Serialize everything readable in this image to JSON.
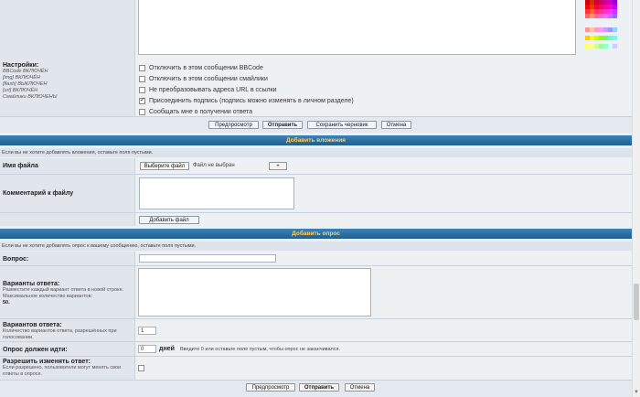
{
  "settings": {
    "title": "Настройки:",
    "status": [
      "BBCode ВКЛЮЧЁН",
      "[img] ВКЛЮЧЁН",
      "[flash] ВЫКЛЮЧЕН",
      "[url] ВКЛЮЧЁН",
      "Смайлики ВКЛЮЧЕНЫ"
    ],
    "options": [
      {
        "label": "Отключить в этом сообщении BBCode",
        "checked": false
      },
      {
        "label": "Отключить в этом сообщении смайлики",
        "checked": false
      },
      {
        "label": "Не преобразовывать адреса URL в ссылки",
        "checked": false
      },
      {
        "label": "Присоединить подпись (подпись можно изменять в личном разделе)",
        "checked": true
      },
      {
        "label": "Сообщать мне о получении ответа",
        "checked": false
      }
    ]
  },
  "buttons": {
    "preview": "Предпросмотр",
    "submit": "Отправить",
    "save_draft": "Сохранить черновик",
    "cancel": "Отмена"
  },
  "attachments": {
    "header": "Добавить вложения",
    "note": "Если вы не хотите добавлять вложения, оставьте поля пустыми.",
    "file_label": "Имя файла",
    "choose_file": "Выберите файл",
    "no_file": "Файл не выбран",
    "add_more": "+",
    "comment_label": "Комментарий к файлу",
    "add_file": "Добавить файл"
  },
  "poll": {
    "header": "Добавить опрос",
    "note": "Если вы не хотите добавлять опрос к вашему сообщению, оставьте поля пустыми.",
    "question_label": "Вопрос:",
    "options_label": "Варианты ответа:",
    "options_help": "Разместите каждый вариант ответа в новой строке. Максимальное количество вариантов:",
    "options_max": "50.",
    "max_options_label": "Вариантов ответа:",
    "max_options_help": "Количество вариантов ответа, разрешённых при голосовании.",
    "max_options_value": "1",
    "duration_label": "Опрос должен идти:",
    "duration_value": "0",
    "duration_unit": "дней",
    "duration_help": "Введите 0 или оставьте поле пустым, чтобы опрос не заканчивался.",
    "allow_change_label": "Разрешить изменять ответ:",
    "allow_change_help": "Если разрешено, пользователи могут менять свои ответы в опросе."
  },
  "palette_colors": [
    [
      "#cc0000",
      "#cc3300",
      "#cc0033",
      "#cc0066",
      "#cc0099",
      "#cc00cc",
      "#9900cc"
    ],
    [
      "#ff0000",
      "#ff3300",
      "#ff0033",
      "#ff0066",
      "#ff0099",
      "#ff00cc",
      "#cc00ff"
    ],
    [
      "#ff3333",
      "#ff6633",
      "#ff3366",
      "#ff3399",
      "#ff33cc",
      "#ff33ff",
      "#cc33ff"
    ],
    [
      "#ff6666",
      "#ff9966",
      "#ff6699",
      "#ff66cc",
      "#ff66ff",
      "#cc66ff",
      "#9966ff"
    ],
    [
      "#ff9999",
      "#ffcc99",
      "#ff99cc",
      "#ff99ff",
      "#cc99ff",
      "#9999ff",
      "#99ccff"
    ],
    [
      "#ffcc00",
      "#ffff00",
      "#ccff00",
      "#99ff00",
      "#66ff66",
      "#66ffcc",
      "#66ffff"
    ],
    [
      "#ffff66",
      "#ffff99",
      "#ccff99",
      "#99ff99",
      "#99ffcc",
      "#ccffff",
      "#ccccff"
    ]
  ]
}
